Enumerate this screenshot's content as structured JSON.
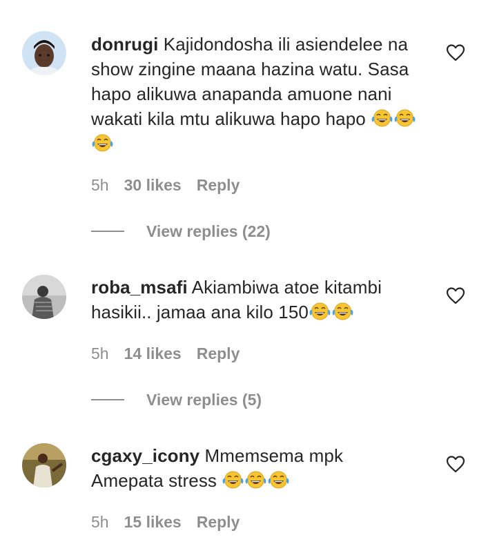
{
  "comments": [
    {
      "username": "donrugi",
      "text": "Kajidondosha ili asiendelee na show zingine maana hazina watu. Sasa hapo alikuwa anapanda amuone nani wakati kila mtu alikuwa hapo hapo",
      "emoji_count": 3,
      "time": "5h",
      "likes": "30 likes",
      "reply_label": "Reply",
      "view_replies": "View replies (22)"
    },
    {
      "username": "roba_msafi",
      "text": "Akiambiwa atoe kitambi hasikii.. jamaa ana kilo 150",
      "emoji_count": 2,
      "time": "5h",
      "likes": "14 likes",
      "reply_label": "Reply",
      "view_replies": "View replies (5)"
    },
    {
      "username": "cgaxy_icony",
      "text": "Mmemsema mpk Amepata stress",
      "emoji_count": 3,
      "time": "5h",
      "likes": "15 likes",
      "reply_label": "Reply"
    }
  ],
  "icons": {
    "like": "heart-outline-icon",
    "emoji": "face-with-tears-of-joy-icon"
  },
  "colors": {
    "text": "#262626",
    "secondary": "#8e8e8e",
    "background": "#ffffff"
  }
}
